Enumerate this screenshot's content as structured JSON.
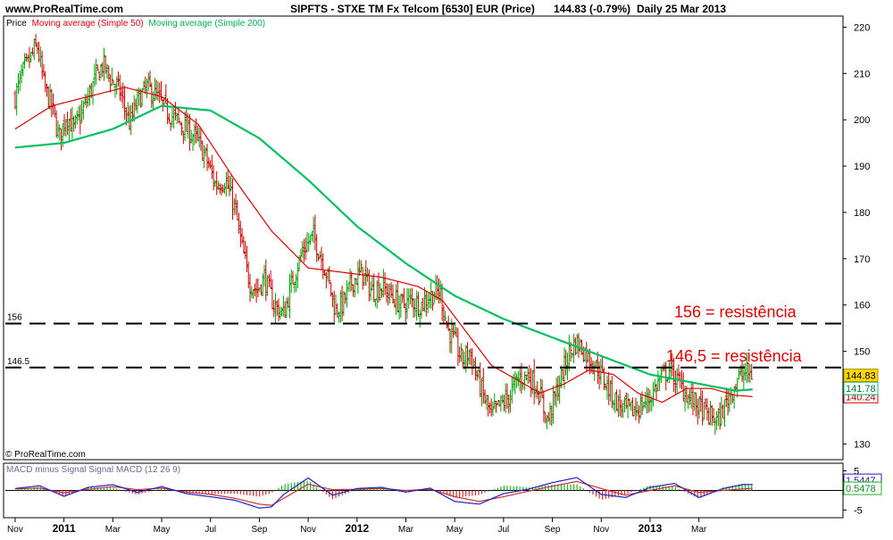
{
  "header": {
    "site": "www.ProRealTime.com",
    "title": "SIPFTS - STXE TM Fx Telcom [6530] EUR (Price)",
    "price": "144.83 (-0.79%)",
    "period": "Daily  25 Mar 2013"
  },
  "legend": {
    "price": "Price",
    "ma50": "Moving average (Simple 50)",
    "ma200": "Moving average (Simple 200)"
  },
  "copyright": "© ProRealTime.com",
  "annotations": [
    {
      "text": "156 = resistência",
      "level": 156,
      "line_label": "156"
    },
    {
      "text": "146,5 = resistência",
      "level": 146.5,
      "line_label": "146.5"
    }
  ],
  "badges": {
    "last_price": "144.83",
    "ma200_value": "141.78",
    "ma50_value": "140.24",
    "macd_value": "1.5447",
    "signal_value": "0.5478"
  },
  "colors": {
    "ma50": "#dd0000",
    "ma200": "#00c060",
    "price_up": "#00a000",
    "price_down": "#cc0000",
    "annotation": "#dd0000",
    "badge_price": "#ffd700",
    "macd": "#2020c0",
    "signal": "#cc3030",
    "hist_up": "#20b020",
    "hist_down": "#cc3030"
  },
  "macd_panel": {
    "label": "MACD minus Signal  Signal  MACD (12 26 9)",
    "ticks": [
      "5",
      "0",
      "-5"
    ]
  },
  "chart_data": {
    "type": "line",
    "y_ticks": [
      220,
      210,
      200,
      190,
      180,
      170,
      160,
      150,
      140,
      130
    ],
    "ylim": [
      127,
      222
    ],
    "x_ticks": [
      {
        "label": "Nov",
        "t": 0,
        "bold": false
      },
      {
        "label": "2011",
        "t": 2,
        "bold": true
      },
      {
        "label": "Mar",
        "t": 4,
        "bold": false
      },
      {
        "label": "May",
        "t": 6,
        "bold": false
      },
      {
        "label": "Jul",
        "t": 8,
        "bold": false
      },
      {
        "label": "Sep",
        "t": 10,
        "bold": false
      },
      {
        "label": "Nov",
        "t": 12,
        "bold": false
      },
      {
        "label": "2012",
        "t": 14,
        "bold": true
      },
      {
        "label": "Mar",
        "t": 16,
        "bold": false
      },
      {
        "label": "May",
        "t": 18,
        "bold": false
      },
      {
        "label": "Jul",
        "t": 20,
        "bold": false
      },
      {
        "label": "Sep",
        "t": 22,
        "bold": false
      },
      {
        "label": "Nov",
        "t": 24,
        "bold": false
      },
      {
        "label": "2013",
        "t": 26,
        "bold": true
      },
      {
        "label": "Mar",
        "t": 28,
        "bold": false
      }
    ],
    "xlim": [
      -0.4,
      33.9
    ],
    "price_keypoints": [
      [
        0,
        205
      ],
      [
        0.3,
        210
      ],
      [
        0.6,
        213
      ],
      [
        0.9,
        216
      ],
      [
        1.2,
        207
      ],
      [
        1.5,
        203
      ],
      [
        1.8,
        196
      ],
      [
        2.1,
        201
      ],
      [
        2.4,
        198
      ],
      [
        2.7,
        201
      ],
      [
        3.0,
        205
      ],
      [
        3.3,
        209
      ],
      [
        3.6,
        212
      ],
      [
        3.9,
        209
      ],
      [
        4.3,
        206
      ],
      [
        4.7,
        199
      ],
      [
        5.0,
        204
      ],
      [
        5.4,
        207
      ],
      [
        5.8,
        205
      ],
      [
        6.2,
        202
      ],
      [
        6.6,
        200
      ],
      [
        7.0,
        198
      ],
      [
        7.4,
        196
      ],
      [
        7.8,
        192
      ],
      [
        8.2,
        186
      ],
      [
        8.6,
        187
      ],
      [
        9.0,
        181
      ],
      [
        9.3,
        172
      ],
      [
        9.6,
        165
      ],
      [
        9.9,
        163
      ],
      [
        10.2,
        166
      ],
      [
        10.6,
        160
      ],
      [
        11.0,
        158
      ],
      [
        11.4,
        166
      ],
      [
        11.8,
        172
      ],
      [
        12.2,
        175
      ],
      [
        12.5,
        171
      ],
      [
        12.8,
        166
      ],
      [
        13.1,
        159
      ],
      [
        13.4,
        160
      ],
      [
        13.8,
        165
      ],
      [
        14.2,
        167
      ],
      [
        14.6,
        163
      ],
      [
        15.0,
        164
      ],
      [
        15.4,
        162
      ],
      [
        15.8,
        160
      ],
      [
        16.2,
        161
      ],
      [
        16.6,
        160
      ],
      [
        17.0,
        162
      ],
      [
        17.4,
        163
      ],
      [
        17.7,
        155
      ],
      [
        18.0,
        152
      ],
      [
        18.3,
        148
      ],
      [
        18.6,
        150
      ],
      [
        18.9,
        145
      ],
      [
        19.2,
        140
      ],
      [
        19.5,
        136
      ],
      [
        19.8,
        138
      ],
      [
        20.2,
        140
      ],
      [
        20.6,
        144
      ],
      [
        21.0,
        145
      ],
      [
        21.4,
        142
      ],
      [
        21.8,
        135
      ],
      [
        22.1,
        140
      ],
      [
        22.4,
        145
      ],
      [
        22.7,
        150
      ],
      [
        23.0,
        152
      ],
      [
        23.3,
        150
      ],
      [
        23.6,
        148
      ],
      [
        23.9,
        146
      ],
      [
        24.2,
        143
      ],
      [
        24.5,
        140
      ],
      [
        24.8,
        138
      ],
      [
        25.2,
        137
      ],
      [
        25.6,
        138
      ],
      [
        26.0,
        140
      ],
      [
        26.4,
        144
      ],
      [
        26.8,
        146
      ],
      [
        27.2,
        143
      ],
      [
        27.6,
        140
      ],
      [
        28.0,
        138
      ],
      [
        28.4,
        136
      ],
      [
        28.8,
        135
      ],
      [
        29.2,
        140
      ],
      [
        29.6,
        144
      ],
      [
        29.9,
        145.5
      ],
      [
        30.2,
        144.83
      ]
    ],
    "ma50_keypoints": [
      [
        0,
        198
      ],
      [
        1.5,
        203
      ],
      [
        3,
        205
      ],
      [
        4.5,
        207
      ],
      [
        6,
        205
      ],
      [
        7.5,
        199
      ],
      [
        9,
        187
      ],
      [
        10.5,
        176
      ],
      [
        12,
        168
      ],
      [
        13.5,
        167
      ],
      [
        15,
        166
      ],
      [
        16.5,
        164
      ],
      [
        17.5,
        161
      ],
      [
        18.5,
        154
      ],
      [
        19.5,
        147
      ],
      [
        20.5,
        144
      ],
      [
        21.5,
        141
      ],
      [
        22.5,
        143
      ],
      [
        23.5,
        146
      ],
      [
        24.5,
        145
      ],
      [
        25.5,
        141
      ],
      [
        26.5,
        139
      ],
      [
        27.5,
        142
      ],
      [
        28.5,
        142
      ],
      [
        29.5,
        140.5
      ],
      [
        30.2,
        140.24
      ]
    ],
    "ma200_keypoints": [
      [
        0,
        194
      ],
      [
        2,
        195
      ],
      [
        4,
        198
      ],
      [
        6,
        203
      ],
      [
        8,
        202
      ],
      [
        10,
        196
      ],
      [
        12,
        187
      ],
      [
        14,
        177
      ],
      [
        16,
        169
      ],
      [
        18,
        162
      ],
      [
        20,
        157
      ],
      [
        22,
        153
      ],
      [
        24,
        149
      ],
      [
        26,
        145
      ],
      [
        28,
        143
      ],
      [
        29.5,
        141.5
      ],
      [
        30.2,
        141.78
      ]
    ],
    "macd_keypoints": [
      [
        0,
        0.5
      ],
      [
        1,
        1.2
      ],
      [
        2,
        -1.5
      ],
      [
        3,
        0.8
      ],
      [
        4,
        1.5
      ],
      [
        5,
        -0.5
      ],
      [
        6,
        1.0
      ],
      [
        7,
        -0.8
      ],
      [
        8,
        -1.6
      ],
      [
        9,
        -2.5
      ],
      [
        10,
        -4.5
      ],
      [
        10.5,
        -4.2
      ],
      [
        11,
        -1.0
      ],
      [
        12,
        3.2
      ],
      [
        13,
        -1.2
      ],
      [
        14,
        0.5
      ],
      [
        15,
        0.8
      ],
      [
        16,
        -0.4
      ],
      [
        17,
        0.6
      ],
      [
        18,
        -2.8
      ],
      [
        19,
        -3.5
      ],
      [
        20,
        -0.8
      ],
      [
        21,
        0.3
      ],
      [
        22,
        2.0
      ],
      [
        23,
        3.3
      ],
      [
        24,
        -1.0
      ],
      [
        25,
        -1.8
      ],
      [
        26,
        0.8
      ],
      [
        27,
        1.8
      ],
      [
        28,
        -1.8
      ],
      [
        29,
        0.5
      ],
      [
        29.8,
        1.5
      ],
      [
        30.2,
        1.5447
      ]
    ],
    "signal_keypoints": [
      [
        0,
        0.4
      ],
      [
        1,
        0.6
      ],
      [
        2,
        -0.6
      ],
      [
        3,
        0.3
      ],
      [
        4,
        1.0
      ],
      [
        5,
        0.2
      ],
      [
        6,
        0.6
      ],
      [
        7,
        -0.4
      ],
      [
        8,
        -1.0
      ],
      [
        9,
        -2.0
      ],
      [
        10,
        -3.5
      ],
      [
        10.5,
        -3.8
      ],
      [
        11,
        -2.0
      ],
      [
        12,
        1.6
      ],
      [
        13,
        0.2
      ],
      [
        14,
        0.3
      ],
      [
        15,
        0.5
      ],
      [
        16,
        0.0
      ],
      [
        17,
        0.3
      ],
      [
        18,
        -1.6
      ],
      [
        19,
        -2.8
      ],
      [
        20,
        -1.6
      ],
      [
        21,
        -0.2
      ],
      [
        22,
        1.1
      ],
      [
        23,
        2.3
      ],
      [
        24,
        0.5
      ],
      [
        25,
        -1.2
      ],
      [
        26,
        0.0
      ],
      [
        27,
        1.2
      ],
      [
        28,
        -0.5
      ],
      [
        29,
        0.0
      ],
      [
        29.8,
        0.4
      ],
      [
        30.2,
        0.5478
      ]
    ],
    "macd_ylim": [
      -6.5,
      6.5
    ]
  }
}
